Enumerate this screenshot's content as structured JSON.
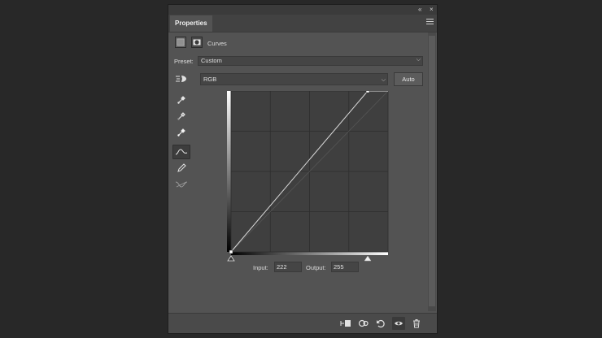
{
  "titlebar": {
    "collapse_glyph": "«",
    "close_glyph": "×"
  },
  "panel": {
    "tab_label": "Properties",
    "menu_icon": "hamburger-icon"
  },
  "header": {
    "adjustment_title": "Curves",
    "icons": [
      "curves-adjustment-icon",
      "mask-icon"
    ]
  },
  "preset": {
    "label": "Preset:",
    "value": "Custom"
  },
  "channel": {
    "value": "RGB"
  },
  "auto_label": "Auto",
  "tools": [
    "targeted-adjustment-icon",
    "black-point-eyedropper-icon",
    "gray-point-eyedropper-icon",
    "white-point-eyedropper-icon",
    "edit-points-icon",
    "draw-curve-icon",
    "smooth-curve-icon"
  ],
  "curve": {
    "points": [
      [
        0,
        0
      ],
      [
        222,
        255
      ]
    ],
    "range": [
      0,
      255
    ],
    "grid_divisions": 4,
    "black_slider": 0,
    "white_slider": 222
  },
  "io": {
    "input_label": "Input:",
    "input_value": "222",
    "output_label": "Output:",
    "output_value": "255"
  },
  "footer_icons": [
    "clip-to-layer-icon",
    "view-previous-state-icon",
    "reset-icon",
    "visibility-eye-icon",
    "delete-icon"
  ],
  "colors": {
    "panel": "#535353",
    "graph_bg": "#3f3f3f",
    "curve": "#d9d9d9",
    "outer_bg": "#282828"
  }
}
